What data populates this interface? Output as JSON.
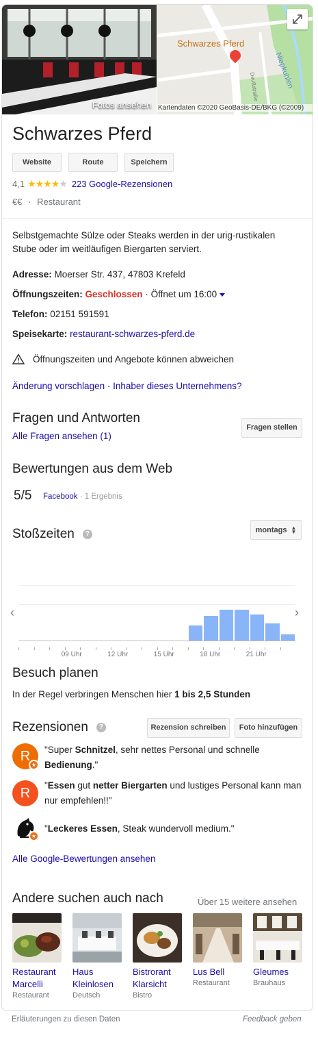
{
  "header": {
    "photos_label": "Fotos ansehen",
    "map_label": "Schwarzes Pferd",
    "map_street_label": "Deußstraße",
    "map_river_label": "Niepkuhlen",
    "map_attribution": "Kartendaten ©2020 GeoBasis-DE/BKG (©2009)"
  },
  "business": {
    "name": "Schwarzes Pferd",
    "rating": "4,1",
    "rating_value": 4.1,
    "reviews_link": "223 Google-Rezensionen",
    "price": "€€",
    "separator": "·",
    "category": "Restaurant"
  },
  "actions": {
    "website": "Website",
    "route": "Route",
    "save": "Speichern"
  },
  "info": {
    "description": "Selbstgemachte Sülze oder Steaks werden in der urig-rustikalen Stube oder im weitläufigen Biergarten serviert.",
    "address_label": "Adresse:",
    "address_value": "Moerser Str. 437, 47803 Krefeld",
    "hours_label": "Öffnungszeiten:",
    "hours_status": "Geschlossen",
    "hours_next": "· Öffnet um 16:00",
    "phone_label": "Telefon:",
    "phone_value": "02151 591591",
    "menu_label": "Speisekarte:",
    "menu_link": "restaurant-schwarzes-pferd.de",
    "warning": "Öffnungszeiten und Angebote können abweichen",
    "suggest_edit": "Änderung vorschlagen",
    "owner_link": "Inhaber dieses Unternehmens?"
  },
  "qa": {
    "title": "Fragen und Antworten",
    "all_link": "Alle Fragen ansehen (1)",
    "ask_button": "Fragen stellen"
  },
  "web_reviews": {
    "title": "Bewertungen aus dem Web",
    "score": "5/5",
    "source": "Facebook",
    "count": "· 1 Ergebnis"
  },
  "popular_times": {
    "title": "Stoßzeiten",
    "day_select": "montags",
    "tick_labels": [
      "09 Uhr",
      "12 Uhr",
      "15 Uhr",
      "18 Uhr",
      "21 Uhr"
    ]
  },
  "chart_data": {
    "type": "bar",
    "categories": [
      "06",
      "07",
      "08",
      "09",
      "10",
      "11",
      "12",
      "13",
      "14",
      "15",
      "16",
      "17",
      "18",
      "19",
      "20",
      "21",
      "22",
      "23"
    ],
    "values": [
      0,
      0,
      0,
      0,
      0,
      0,
      0,
      0,
      0,
      0,
      0,
      24,
      40,
      50,
      50,
      42,
      28,
      10
    ],
    "ylim": [
      0,
      100
    ]
  },
  "visit": {
    "title": "Besuch planen",
    "text_prefix": "In der Regel verbringen Menschen hier",
    "text_bold": "1 bis 2,5 Stunden"
  },
  "reviews": {
    "title": "Rezensionen",
    "write_button": "Rezension schreiben",
    "photo_button": "Foto hinzufügen",
    "items": [
      {
        "avatar_letter": "R",
        "color": "#ef6c00",
        "parts": [
          "\"Super ",
          "Schnitzel",
          ", sehr nettes Personal und schnelle ",
          "Bedienung",
          ".\""
        ]
      },
      {
        "avatar_letter": "R",
        "color": "#f4511e",
        "parts": [
          "\"",
          "Essen",
          " gut ",
          "netter Biergarten",
          " und lustiges Personal kann man nur empfehlen!!\""
        ]
      },
      {
        "avatar_letter": "",
        "color": "#222222",
        "parts": [
          "\"",
          "Leckeres Essen",
          ", Steak wundervoll medium.\""
        ]
      }
    ],
    "all_link": "Alle Google-Bewertungen ansehen"
  },
  "related": {
    "title": "Andere suchen auch nach",
    "more_link": "Über 15 weitere ansehen",
    "items": [
      {
        "name": "Restaurant Marcelli",
        "type": "Restaurant"
      },
      {
        "name": "Haus Kleinlosen",
        "type": "Deutsch"
      },
      {
        "name": "Bistrorant Klarsicht",
        "type": "Bistro"
      },
      {
        "name": "Lus Bell",
        "type": "Restaurant"
      },
      {
        "name": "Gleumes",
        "type": "Brauhaus"
      }
    ]
  },
  "footer": {
    "explanations": "Erläuterungen zu diesen Daten",
    "feedback": "Feedback geben"
  },
  "colors": {
    "link": "#1a0dab",
    "closed": "#d93025",
    "star": "#fbbc04",
    "bar": "#8ab4f8",
    "map_green": "#b5dfa3",
    "map_water": "#aadaff"
  }
}
